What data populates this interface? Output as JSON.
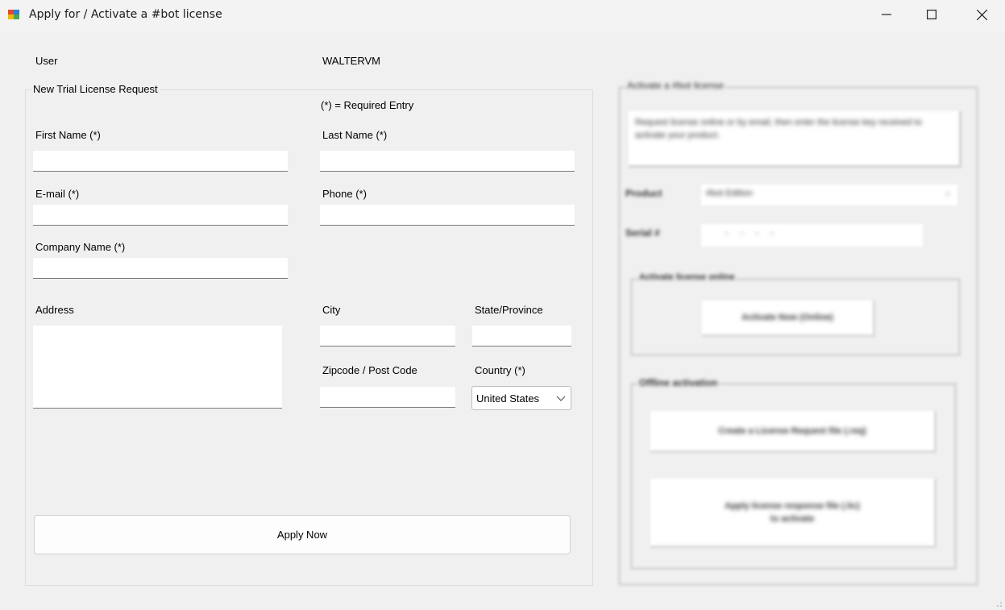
{
  "window": {
    "title": "Apply for / Activate a #bot license",
    "controls": [
      "minimize-icon",
      "maximize-icon",
      "close-icon"
    ]
  },
  "user": {
    "label": "User",
    "value": "WALTERVM"
  },
  "trial": {
    "group_title": "New Trial License Request",
    "required_note": "(*) = Required Entry",
    "first_name": {
      "label": "First Name (*)",
      "value": ""
    },
    "last_name": {
      "label": "Last Name (*)",
      "value": ""
    },
    "email": {
      "label": "E-mail (*)",
      "value": ""
    },
    "phone": {
      "label": "Phone (*)",
      "value": ""
    },
    "company": {
      "label": "Company Name (*)",
      "value": ""
    },
    "address": {
      "label": "Address",
      "value": ""
    },
    "city": {
      "label": "City",
      "value": ""
    },
    "state": {
      "label": "State/Province",
      "value": ""
    },
    "zip": {
      "label": "Zipcode / Post Code",
      "value": ""
    },
    "country": {
      "label": "Country (*)",
      "value": "United States"
    },
    "apply_button": "Apply Now"
  },
  "activation": {
    "group_title": "Activate a #bot license",
    "info_text": "Request license online or by email, then enter the license key received to activate your product.",
    "product_label": "Product",
    "product_value": "#bot Edition",
    "serial_label": "Serial #",
    "serial_value": "-  -  -  -",
    "online_group_title": "Activate license online",
    "online_button": "Activate Now (Online)",
    "email_group_title": "Offline activation",
    "email_request_button": "Create a License Request file (.req)",
    "email_apply_button": "Apply license response file (.lic)\nto activate"
  },
  "colors": {
    "window_bg": "#f0f0f0",
    "titlebar_bg": "#f3f3f3",
    "field_bg": "#ffffff",
    "border": "#dcdcdc"
  }
}
